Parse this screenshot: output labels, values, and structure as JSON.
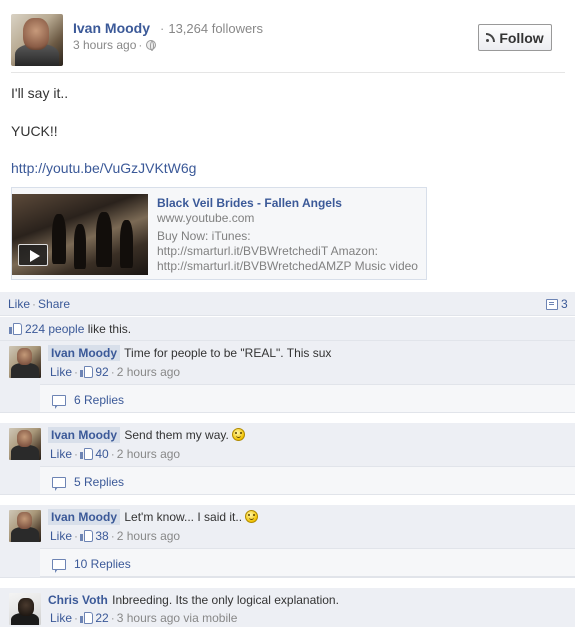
{
  "post": {
    "author": "Ivan Moody",
    "followers": "13,264 followers",
    "timestamp": "3 hours ago",
    "follow_label": "Follow",
    "text_line1": "I'll say it..",
    "text_line2": "YUCK!!",
    "link": "http://youtu.be/VuGzJVKtW6g"
  },
  "share": {
    "title": "Black Veil Brides - Fallen Angels",
    "domain": "www.youtube.com",
    "description": "Buy Now: iTunes: http://smarturl.it/BVBWretchediT Amazon: http://smarturl.it/BVBWretchedAMZP Music video"
  },
  "actions": {
    "like": "Like",
    "share": "Share",
    "comment_count": "3",
    "likes_count": "224 people",
    "likes_suffix": "like this."
  },
  "comments": [
    {
      "author": "Ivan Moody",
      "text": "Time for people to be \"REAL\". This sux",
      "like": "Like",
      "likes": "92",
      "time": "2 hours ago",
      "replies": "6 Replies"
    },
    {
      "author": "Ivan Moody",
      "text": "Send them my way.",
      "like": "Like",
      "likes": "40",
      "time": "2 hours ago",
      "replies": "5 Replies"
    },
    {
      "author": "Ivan Moody",
      "text": "Let'm know... I said it..",
      "like": "Like",
      "likes": "38",
      "time": "2 hours ago",
      "replies": "10 Replies"
    },
    {
      "author": "Chris Voth",
      "text": "Inbreeding. Its the only logical explanation.",
      "like": "Like",
      "likes": "22",
      "time": "3 hours ago via mobile"
    }
  ],
  "colors": {
    "link": "#3b5998",
    "panel": "#edeff4",
    "muted": "#888888"
  }
}
